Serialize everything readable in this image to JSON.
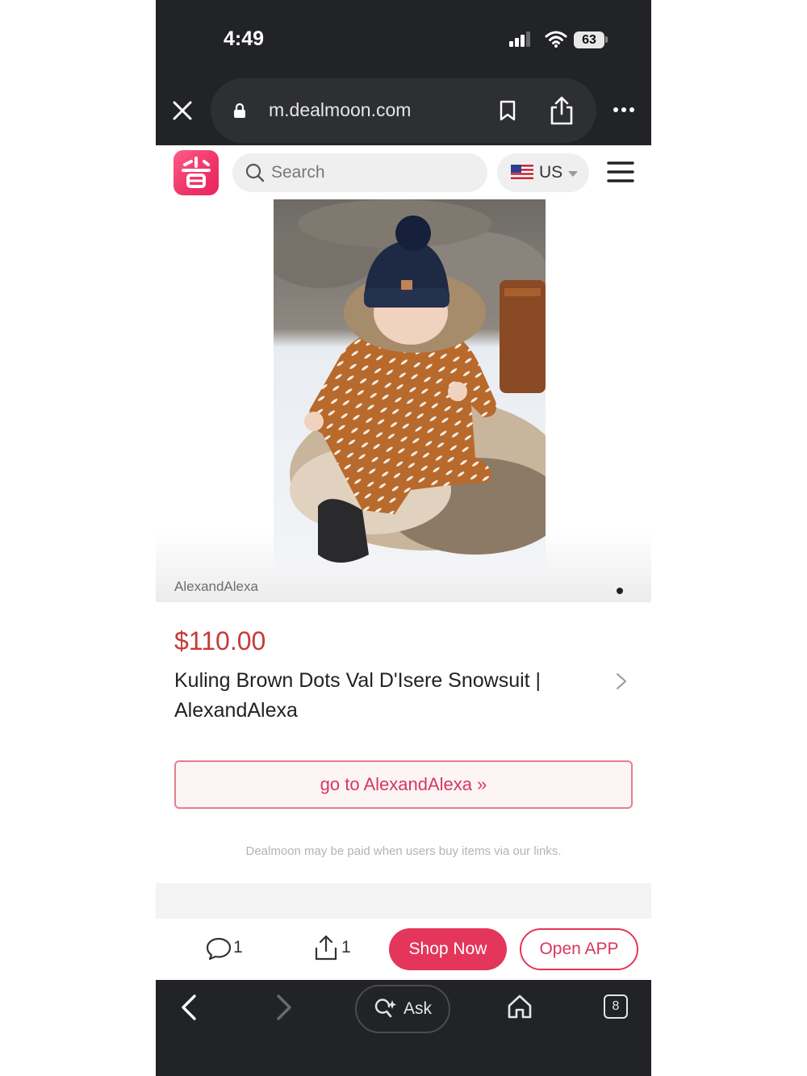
{
  "status_bar": {
    "time": "4:49",
    "battery": "63"
  },
  "browser": {
    "url": "m.dealmoon.com"
  },
  "header": {
    "search_placeholder": "Search",
    "region": "US"
  },
  "product": {
    "image_source": "AlexandAlexa",
    "price": "$110.00",
    "title": "Kuling Brown Dots Val D'Isere Snowsuit | AlexandAlexa",
    "store_button": "go to AlexandAlexa »",
    "disclaimer": "Dealmoon may be paid when users buy items via our links."
  },
  "action_bar": {
    "comment_count": "1",
    "share_count": "1",
    "shop_now": "Shop Now",
    "open_app": "Open APP"
  },
  "bottom_bar": {
    "ask_label": "Ask",
    "tab_count": "8"
  },
  "colors": {
    "brand": "#e4355b",
    "price": "#c73a3a",
    "chrome": "#222326"
  }
}
